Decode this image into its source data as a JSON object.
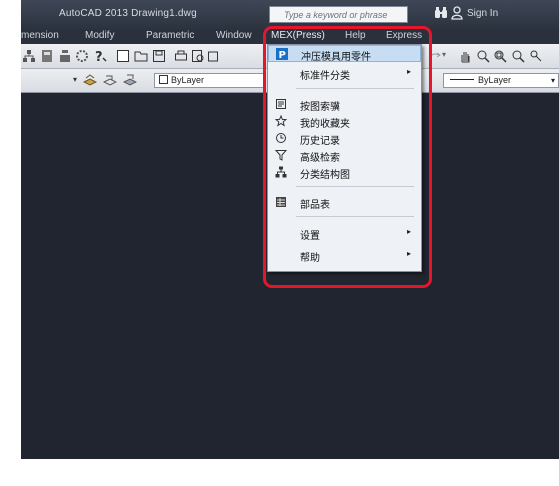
{
  "titlebar": {
    "title": "AutoCAD 2013   Drawing1.dwg",
    "search_placeholder": "Type a keyword or phrase",
    "sign_in": "Sign In"
  },
  "menubar": {
    "items": [
      "mension",
      "Modify",
      "Parametric",
      "Window",
      "MEX(Press)",
      "Help",
      "Express"
    ]
  },
  "properties": {
    "layer_color": "ByLayer",
    "linetype": "ByLayer"
  },
  "dropdown": {
    "items": [
      {
        "label": "冲压模具用零件",
        "icon": "mex-p-icon",
        "submenu": false,
        "highlighted": true
      },
      {
        "label": "标准件分类",
        "icon": "",
        "submenu": true
      },
      {
        "label": "按图索骥",
        "icon": "search-drawing-icon",
        "submenu": false
      },
      {
        "label": "我的收藏夹",
        "icon": "favorites-icon",
        "submenu": false
      },
      {
        "label": "历史记录",
        "icon": "history-icon",
        "submenu": false
      },
      {
        "label": "高级检索",
        "icon": "filter-icon",
        "submenu": false
      },
      {
        "label": "分类结构图",
        "icon": "tree-icon",
        "submenu": false
      },
      {
        "label": "部品表",
        "icon": "parts-table-icon",
        "submenu": false
      },
      {
        "label": "设置",
        "icon": "",
        "submenu": true
      },
      {
        "label": "帮助",
        "icon": "",
        "submenu": true
      }
    ],
    "submenu_arrow": "▸"
  },
  "colors": {
    "canvas_bg": "#20252f",
    "highlight_frame": "#e3162b",
    "menu_highlight": "#c7ddf3"
  }
}
